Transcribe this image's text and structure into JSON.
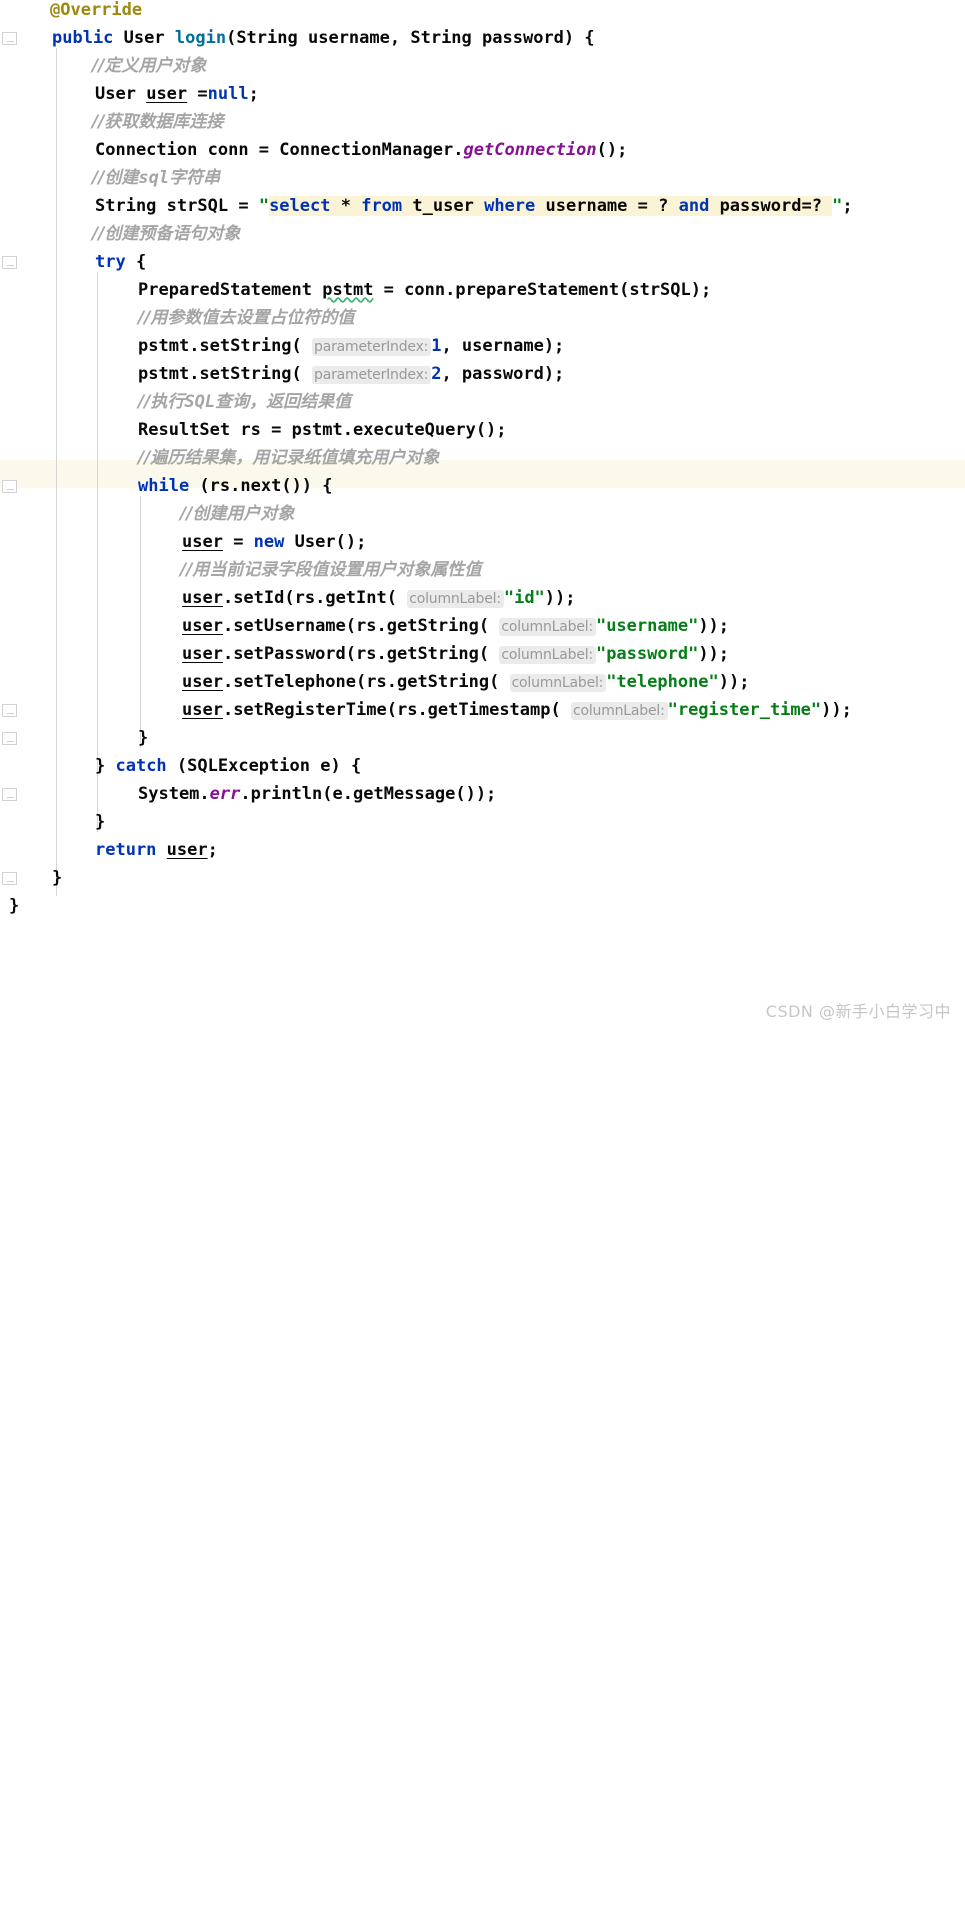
{
  "editor": {
    "language": "Java",
    "theme": "IntelliJ Light",
    "colors": {
      "background": "#ffffff",
      "keyword": "#0033b3",
      "string": "#067d17",
      "comment": "#a5a5a5",
      "annotation": "#9e880d",
      "method_declaration": "#00709b",
      "static_field": "#871094",
      "number": "#0033b3",
      "caret_line_highlight": "#fbf8ec",
      "injected_sql_background": "#fbf3d5",
      "parameter_hint_background": "#ebebeb",
      "parameter_hint_text": "#999999",
      "indent_guide": "#d6d6d6",
      "error_squiggle": "#3cb371"
    },
    "caret_line_index": 16
  },
  "code": {
    "lines": [
      {
        "indent": 0,
        "text": "@Override"
      },
      {
        "indent": 0,
        "text": "public User login(String username, String password) {"
      },
      {
        "indent": 1,
        "text": "//定义用户对象"
      },
      {
        "indent": 1,
        "text": "User user =null;"
      },
      {
        "indent": 1,
        "text": "//获取数据库连接"
      },
      {
        "indent": 1,
        "text": "Connection conn = ConnectionManager.getConnection();"
      },
      {
        "indent": 1,
        "text": "//创建sql字符串"
      },
      {
        "indent": 1,
        "text": "String strSQL = \"select * from t_user where username = ? and password=? \";"
      },
      {
        "indent": 1,
        "text": "//创建预备语句对象"
      },
      {
        "indent": 1,
        "text": "try {"
      },
      {
        "indent": 2,
        "text": "PreparedStatement pstmt = conn.prepareStatement(strSQL);"
      },
      {
        "indent": 2,
        "text": "//用参数值去设置占位符的值"
      },
      {
        "indent": 2,
        "text": "pstmt.setString( parameterIndex: 1, username);"
      },
      {
        "indent": 2,
        "text": "pstmt.setString( parameterIndex: 2, password);"
      },
      {
        "indent": 2,
        "text": "//执行SQL查询，返回结果值"
      },
      {
        "indent": 2,
        "text": "ResultSet rs = pstmt.executeQuery();"
      },
      {
        "indent": 2,
        "text": "//遍历结果集，用记录纸值填充用户对象"
      },
      {
        "indent": 2,
        "text": "while (rs.next()) {"
      },
      {
        "indent": 3,
        "text": "//创建用户对象"
      },
      {
        "indent": 3,
        "text": "user = new User();"
      },
      {
        "indent": 3,
        "text": "//用当前记录字段值设置用户对象属性值"
      },
      {
        "indent": 3,
        "text": "user.setId(rs.getInt( columnLabel: \"id\"));"
      },
      {
        "indent": 3,
        "text": "user.setUsername(rs.getString( columnLabel: \"username\"));"
      },
      {
        "indent": 3,
        "text": "user.setPassword(rs.getString( columnLabel: \"password\"));"
      },
      {
        "indent": 3,
        "text": "user.setTelephone(rs.getString( columnLabel: \"telephone\"));"
      },
      {
        "indent": 3,
        "text": "user.setRegisterTime(rs.getTimestamp( columnLabel: \"register_time\"));"
      },
      {
        "indent": 2,
        "text": "}"
      },
      {
        "indent": 1,
        "text": "} catch (SQLException e) {"
      },
      {
        "indent": 2,
        "text": "System.err.println(e.getMessage());"
      },
      {
        "indent": 1,
        "text": "}"
      },
      {
        "indent": 1,
        "text": "return user;"
      },
      {
        "indent": 0,
        "text": "}"
      },
      {
        "indent": -1,
        "text": "}"
      }
    ],
    "sql_string": {
      "full": "\"select * from t_user where username = ? and password=? \";",
      "keywords": [
        "select",
        "from",
        "where",
        "and"
      ],
      "identifiers": [
        "t_user",
        "username",
        "password"
      ],
      "placeholders": "?"
    },
    "parameter_hints": [
      {
        "name": "parameterIndex:",
        "value": "1"
      },
      {
        "name": "parameterIndex:",
        "value": "2"
      },
      {
        "name": "columnLabel:",
        "value": "\"id\""
      },
      {
        "name": "columnLabel:",
        "value": "\"username\""
      },
      {
        "name": "columnLabel:",
        "value": "\"password\""
      },
      {
        "name": "columnLabel:",
        "value": "\"telephone\""
      },
      {
        "name": "columnLabel:",
        "value": "\"register_time\""
      }
    ],
    "tokens": {
      "annotation": "@Override",
      "kw_public": "public",
      "kw_null": "null",
      "kw_try": "try",
      "kw_while": "while",
      "kw_new": "new",
      "kw_return": "return",
      "kw_catch": "catch",
      "method_name": "login",
      "class_user": "User",
      "class_connection": "Connection",
      "class_connection_manager": "ConnectionManager",
      "class_prepared_statement": "PreparedStatement",
      "class_result_set": "ResultSet",
      "class_sql_exception": "SQLException",
      "class_string": "String",
      "class_system": "System",
      "field_err": "err",
      "var_user": "user",
      "var_conn": "conn",
      "var_pstmt": "pstmt",
      "var_rs": "rs",
      "var_str_sql": "strSQL",
      "var_e": "e",
      "param_username": "username",
      "param_password": "password"
    }
  },
  "watermark": {
    "text": "CSDN @新手小白学习中"
  }
}
